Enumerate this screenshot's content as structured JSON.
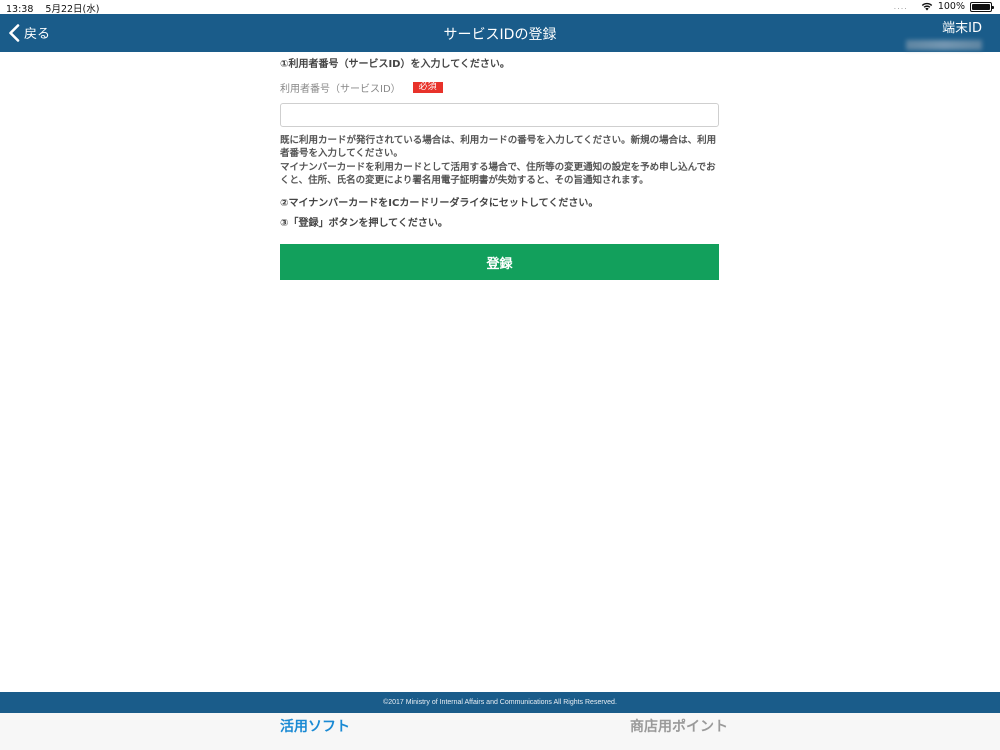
{
  "statusbar": {
    "time": "13:38",
    "date": "5月22日(水)",
    "battery": "100%"
  },
  "header": {
    "back_label": "戻る",
    "title": "サービスIDの登録",
    "terminal_label": "端末ID"
  },
  "form": {
    "step1": "①利用者番号（サービスID）を入力してください。",
    "field_label": "利用者番号（サービスID）",
    "required_badge": "必須",
    "input_value": "",
    "note1": "既に利用カードが発行されている場合は、利用カードの番号を入力してください。新規の場合は、利用者番号を入力してください。",
    "note2": "マイナンバーカードを利用カードとして活用する場合で、住所等の変更通知の設定を予め申し込んでおくと、住所、氏名の変更により署名用電子証明書が失効すると、その旨通知されます。",
    "step2": "②マイナンバーカードをICカードリーダライタにセットしてください。",
    "step3": "③「登録」ボタンを押してください。",
    "register_label": "登録"
  },
  "footer": {
    "copyright": "©2017 Ministry of Internal Affairs and Communications All Rights Reserved."
  },
  "tabs": [
    {
      "label": "活用ソフト",
      "active": true
    },
    {
      "label": "商店用ポイント",
      "active": false
    }
  ],
  "colors": {
    "navbar": "#1a5c8a",
    "button": "#12a05c",
    "required": "#e8322a",
    "active_tab": "#1a8ad4"
  }
}
